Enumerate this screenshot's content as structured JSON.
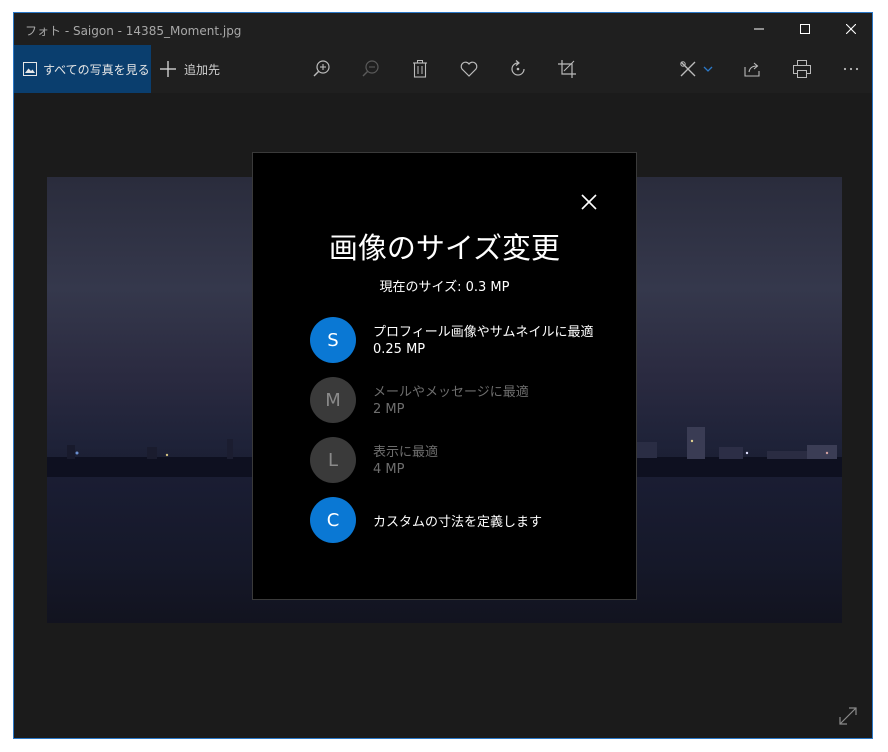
{
  "window": {
    "title": "フォト - Saigon - 14385_Moment.jpg",
    "controls": [
      "minimize-icon",
      "maximize-icon",
      "close-icon"
    ]
  },
  "toolbar": {
    "all_photos_label": "すべての写真を見る",
    "add_to_label": "追加先",
    "icons": [
      "zoom-in-icon",
      "zoom-out-icon",
      "delete-icon",
      "favorite-heart-icon",
      "rotate-icon",
      "crop-icon",
      "edit-create-icon",
      "share-icon",
      "print-icon",
      "more-icon"
    ]
  },
  "dialog": {
    "title": "画像のサイズ変更",
    "current_size": "現在のサイズ: 0.3 MP",
    "options": [
      {
        "letter": "S",
        "label": "プロフィール画像やサムネイルに最適",
        "size": "0.25 MP",
        "enabled": true
      },
      {
        "letter": "M",
        "label": "メールやメッセージに最適",
        "size": "2 MP",
        "enabled": false
      },
      {
        "letter": "L",
        "label": "表示に最適",
        "size": "4 MP",
        "enabled": false
      },
      {
        "letter": "C",
        "label": "カスタムの寸法を定義します",
        "size": "",
        "enabled": true
      }
    ]
  },
  "colors": {
    "accent": "#0a78d4",
    "selected_nav": "#0a3e6e",
    "window_border": "#2b78c7",
    "dialog_bg": "#000000"
  }
}
